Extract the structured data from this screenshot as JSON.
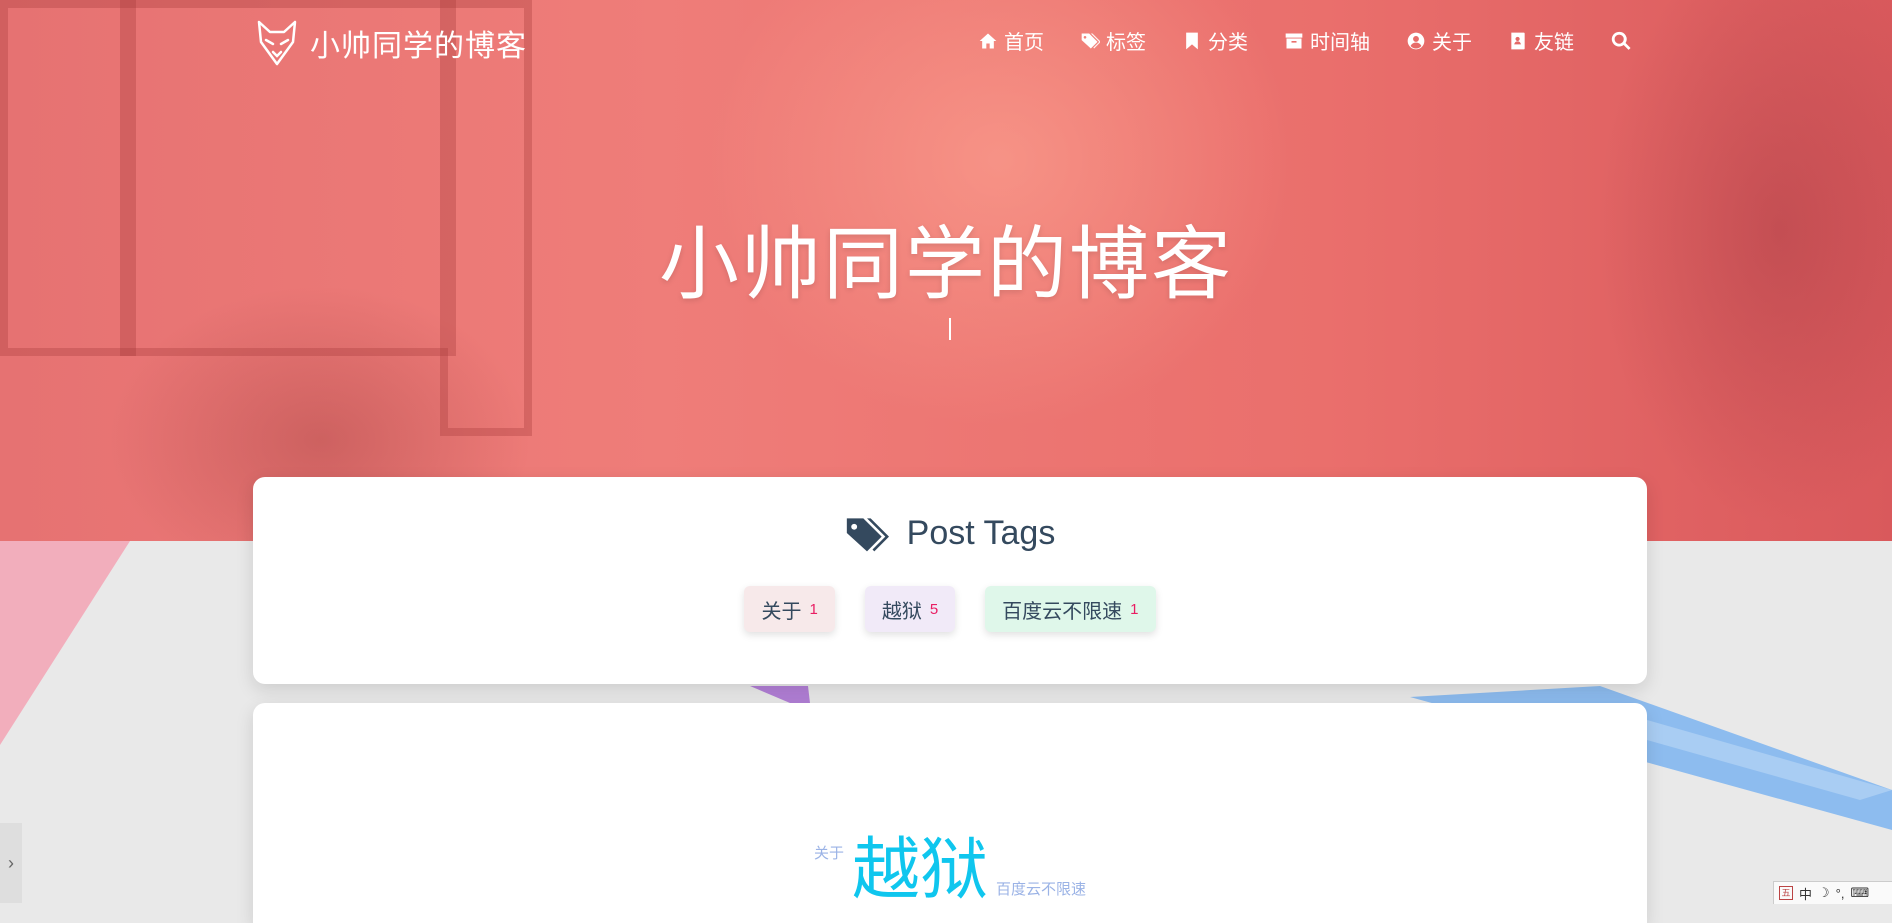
{
  "site": {
    "brand_title": "小帅同学的博客"
  },
  "nav": {
    "items": [
      {
        "label": "首页",
        "icon": "home-icon"
      },
      {
        "label": "标签",
        "icon": "tags-icon"
      },
      {
        "label": "分类",
        "icon": "bookmark-icon"
      },
      {
        "label": "时间轴",
        "icon": "archive-icon"
      },
      {
        "label": "关于",
        "icon": "user-circle-icon"
      },
      {
        "label": "友链",
        "icon": "address-book-icon"
      }
    ],
    "search_icon": "search-icon"
  },
  "hero": {
    "title": "小帅同学的博客"
  },
  "tags_card": {
    "heading": "Post Tags",
    "chips": [
      {
        "name": "关于",
        "count": "1",
        "color": "#f7e9ea"
      },
      {
        "name": "越狱",
        "count": "5",
        "color": "#f1eaf8"
      },
      {
        "name": "百度云不限速",
        "count": "1",
        "color": "#dff7ea"
      }
    ]
  },
  "tag_cloud": {
    "words": [
      {
        "text": "关于",
        "color": "#9bb3e6"
      },
      {
        "text": "越狱",
        "color": "#0fc6ee"
      },
      {
        "text": "百度云不限速",
        "color": "#9bb3e6"
      }
    ]
  },
  "side_toggle": {
    "label": "›"
  },
  "ime": {
    "mode": "中",
    "extra": "°,"
  }
}
